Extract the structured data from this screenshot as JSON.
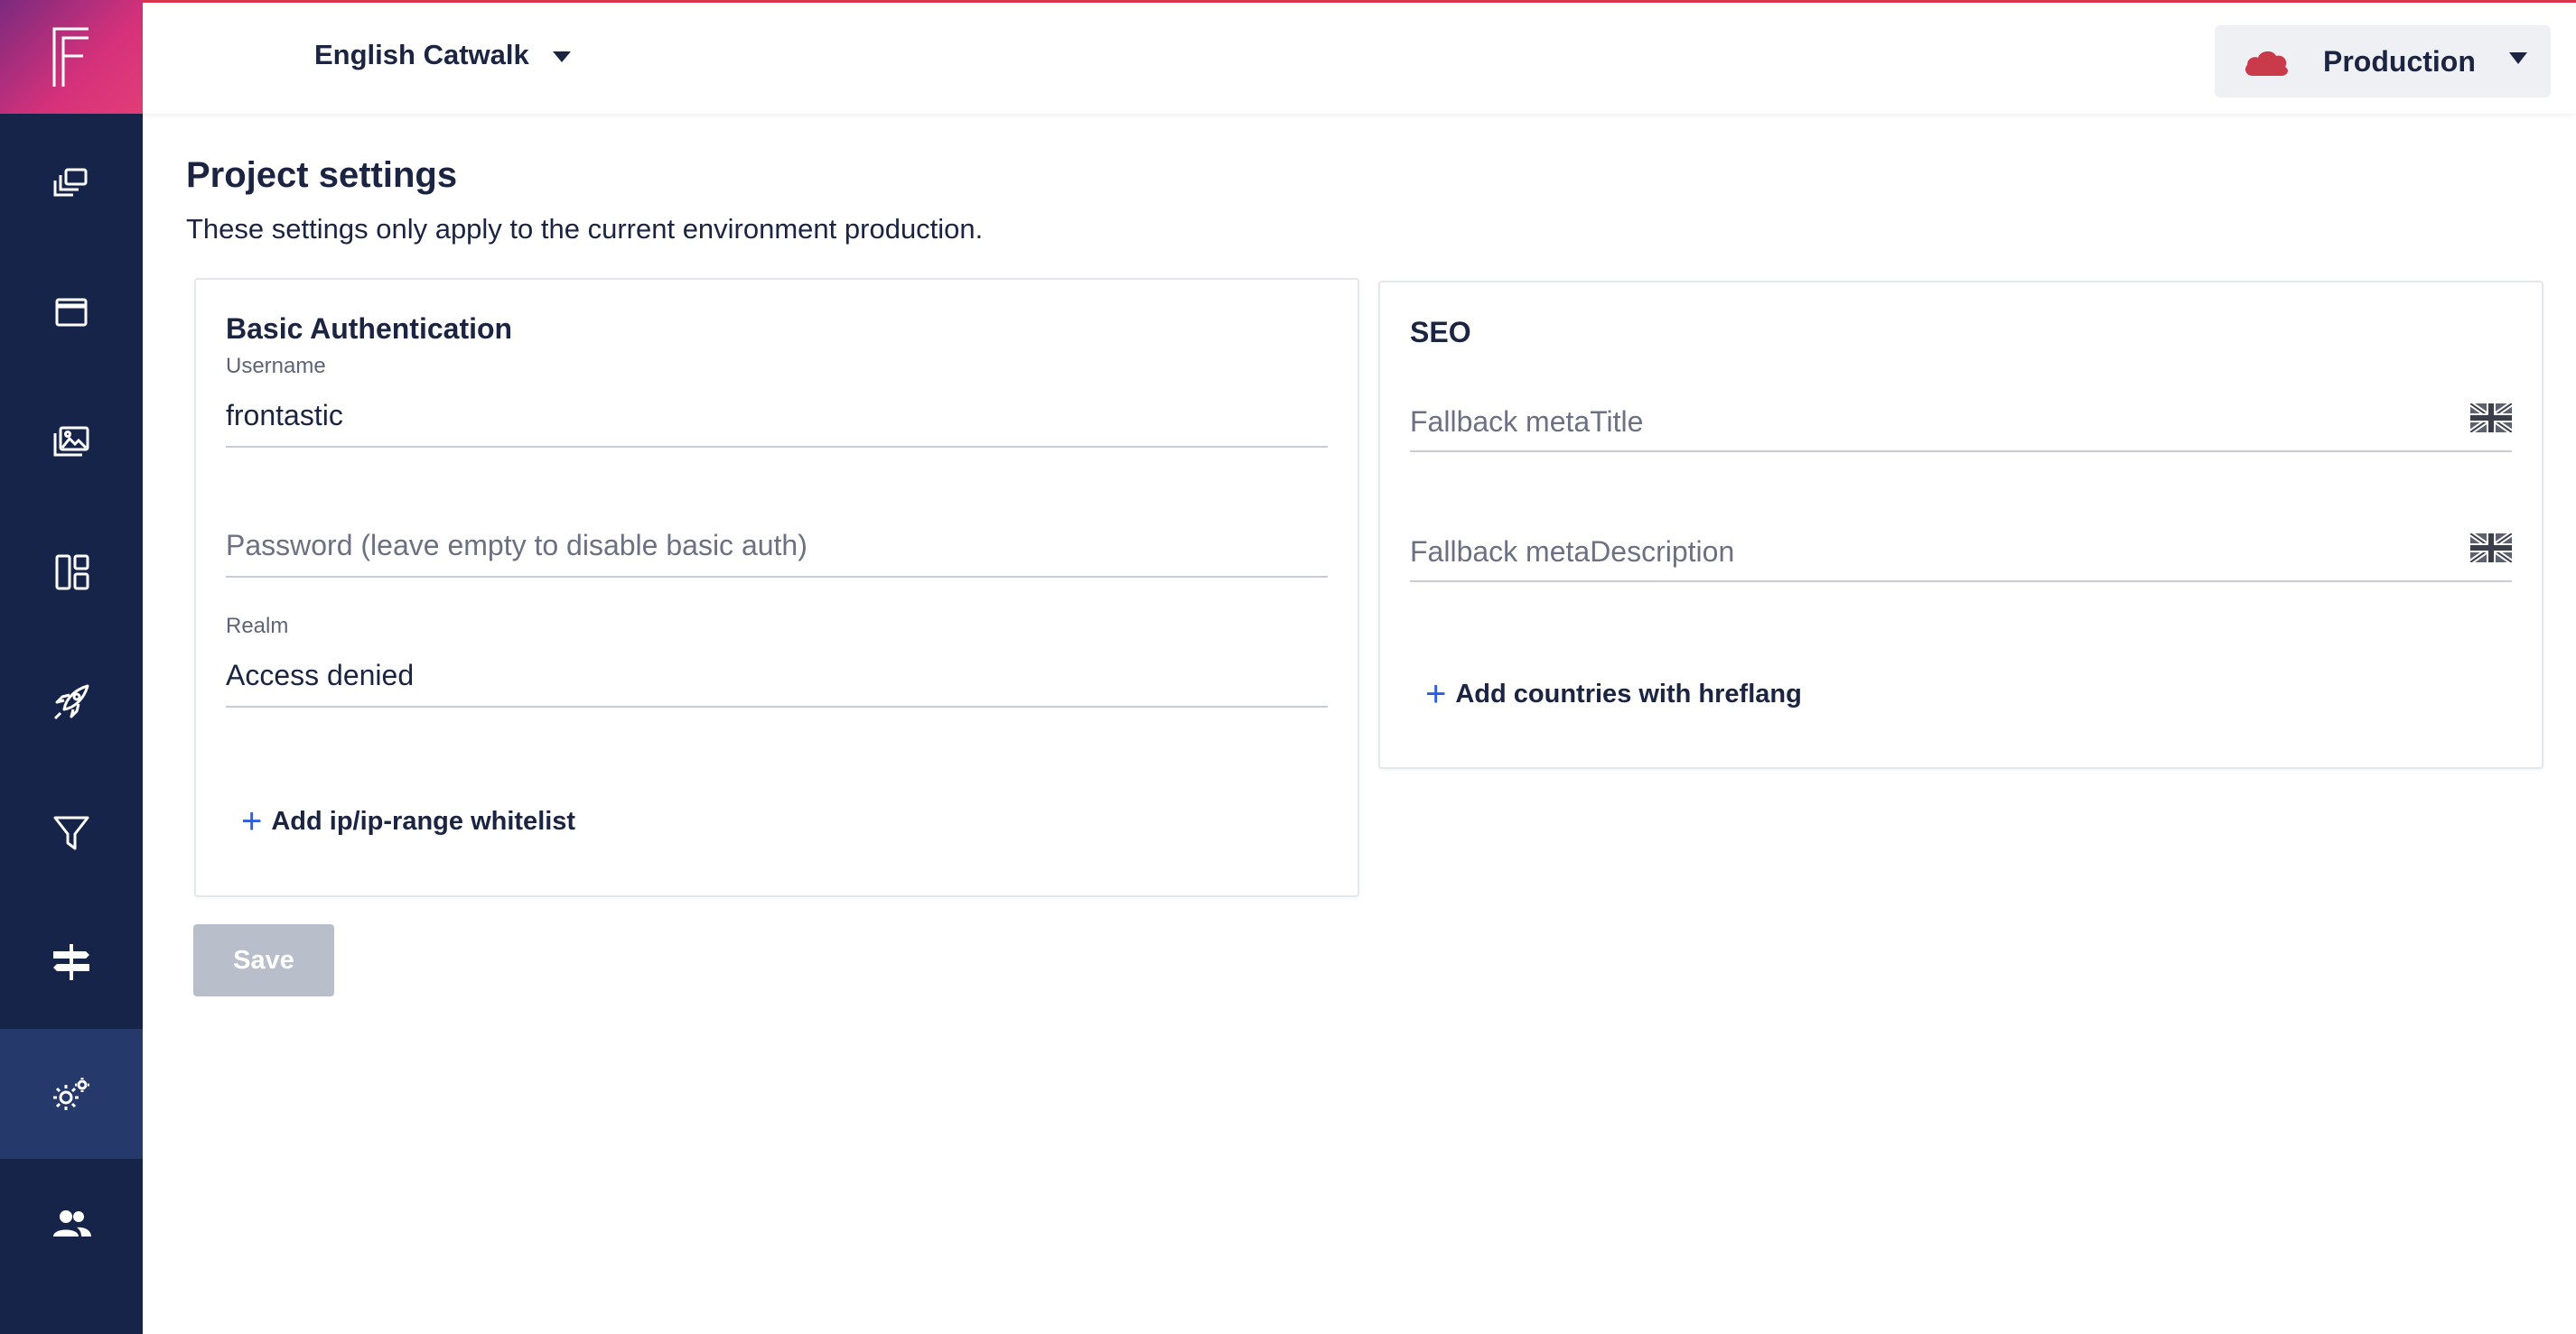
{
  "header": {
    "project_name": "English Catwalk",
    "environment": "Production"
  },
  "sidebar": {
    "items": [
      {
        "icon": "pages-icon"
      },
      {
        "icon": "window-icon"
      },
      {
        "icon": "media-icon"
      },
      {
        "icon": "dashboard-icon"
      },
      {
        "icon": "rocket-icon"
      },
      {
        "icon": "filter-icon"
      },
      {
        "icon": "signpost-icon"
      },
      {
        "icon": "settings-icon",
        "active": true
      },
      {
        "icon": "users-icon"
      }
    ]
  },
  "page": {
    "title": "Project settings",
    "subtitle": "These settings only apply to the current environment production."
  },
  "basic_auth": {
    "title": "Basic Authentication",
    "username_label": "Username",
    "username_value": "frontastic",
    "password_placeholder": "Password (leave empty to disable basic auth)",
    "realm_label": "Realm",
    "realm_value": "Access denied",
    "add_whitelist": "Add ip/ip-range whitelist"
  },
  "seo": {
    "title": "SEO",
    "meta_title_placeholder": "Fallback metaTitle",
    "meta_description_placeholder": "Fallback metaDescription",
    "add_countries": "Add countries with hreflang"
  },
  "actions": {
    "save": "Save"
  },
  "colors": {
    "sidebar": "#172449",
    "sidebar_active": "#253a6a",
    "accent": "#2b5fe0",
    "brand_gradient_start": "#7b2a7e",
    "brand_gradient_end": "#e23d78",
    "env_cloud": "#c93a4b",
    "save_disabled": "#b9bfca"
  }
}
